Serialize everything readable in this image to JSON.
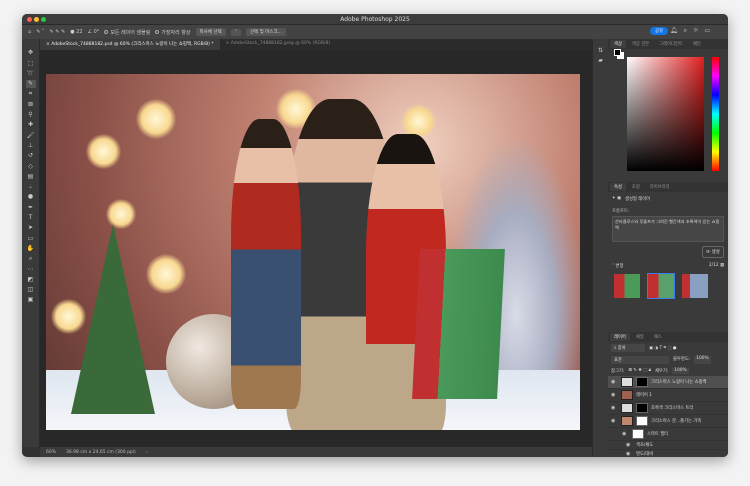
{
  "app": {
    "title": "Adobe Photoshop 2025",
    "share": "공유"
  },
  "options": {
    "sample_all": "모든 레이어 샘플링",
    "enhance_edge": "가장자리 향상",
    "select_subject": "피사체 선택",
    "select_mask": "선택 및 마스크...",
    "angle": "0°",
    "size": "22"
  },
  "tabs": [
    {
      "label": "AdobeStock_74888182.psd @ 60% (크리스마스 노랑이 나는 쇼핑백, RGB/8) *"
    },
    {
      "label": "AdobeStock_74888182.jpeg @ 60% (RGB/8)"
    }
  ],
  "status": {
    "zoom": "60%",
    "doc_size": "36.98 cm x 24.65 cm (300 ppi)"
  },
  "color_panel": {
    "tabs": [
      "색상",
      "색상 견본",
      "그레이디언트",
      "패턴"
    ],
    "fg": "#000000",
    "bg": "#ffffff",
    "hue": "#e02020"
  },
  "properties": {
    "tabs": [
      "속성",
      "조정",
      "라이브러리"
    ],
    "layer_type": "생성형 레이어",
    "prompt_label": "프롬프트:",
    "prompt": "산타클로스와 루돌프가 그려진 빨간색과 초록색이 있는 쇼핑백",
    "generate": "생성",
    "variations_label": "변형",
    "variations_count": "2/12"
  },
  "layers_panel": {
    "tabs": [
      "레이어",
      "채널",
      "패스"
    ],
    "filter": "종류",
    "blend": "표준",
    "opacity_label": "불투명도:",
    "opacity": "100%",
    "lock_label": "잠그기:",
    "fill_label": "채우기:",
    "fill": "100%",
    "layers": [
      {
        "name": "크리스마스 노랑이 나는 쇼핑백"
      },
      {
        "name": "레이어 1"
      },
      {
        "name": "초록색 크리스마스 트리"
      },
      {
        "name": "크리스마스 분...즐기는 가족"
      },
      {
        "name": "스마트 필터"
      },
      {
        "name": "색조/채도"
      },
      {
        "name": "명도/대비"
      }
    ]
  }
}
